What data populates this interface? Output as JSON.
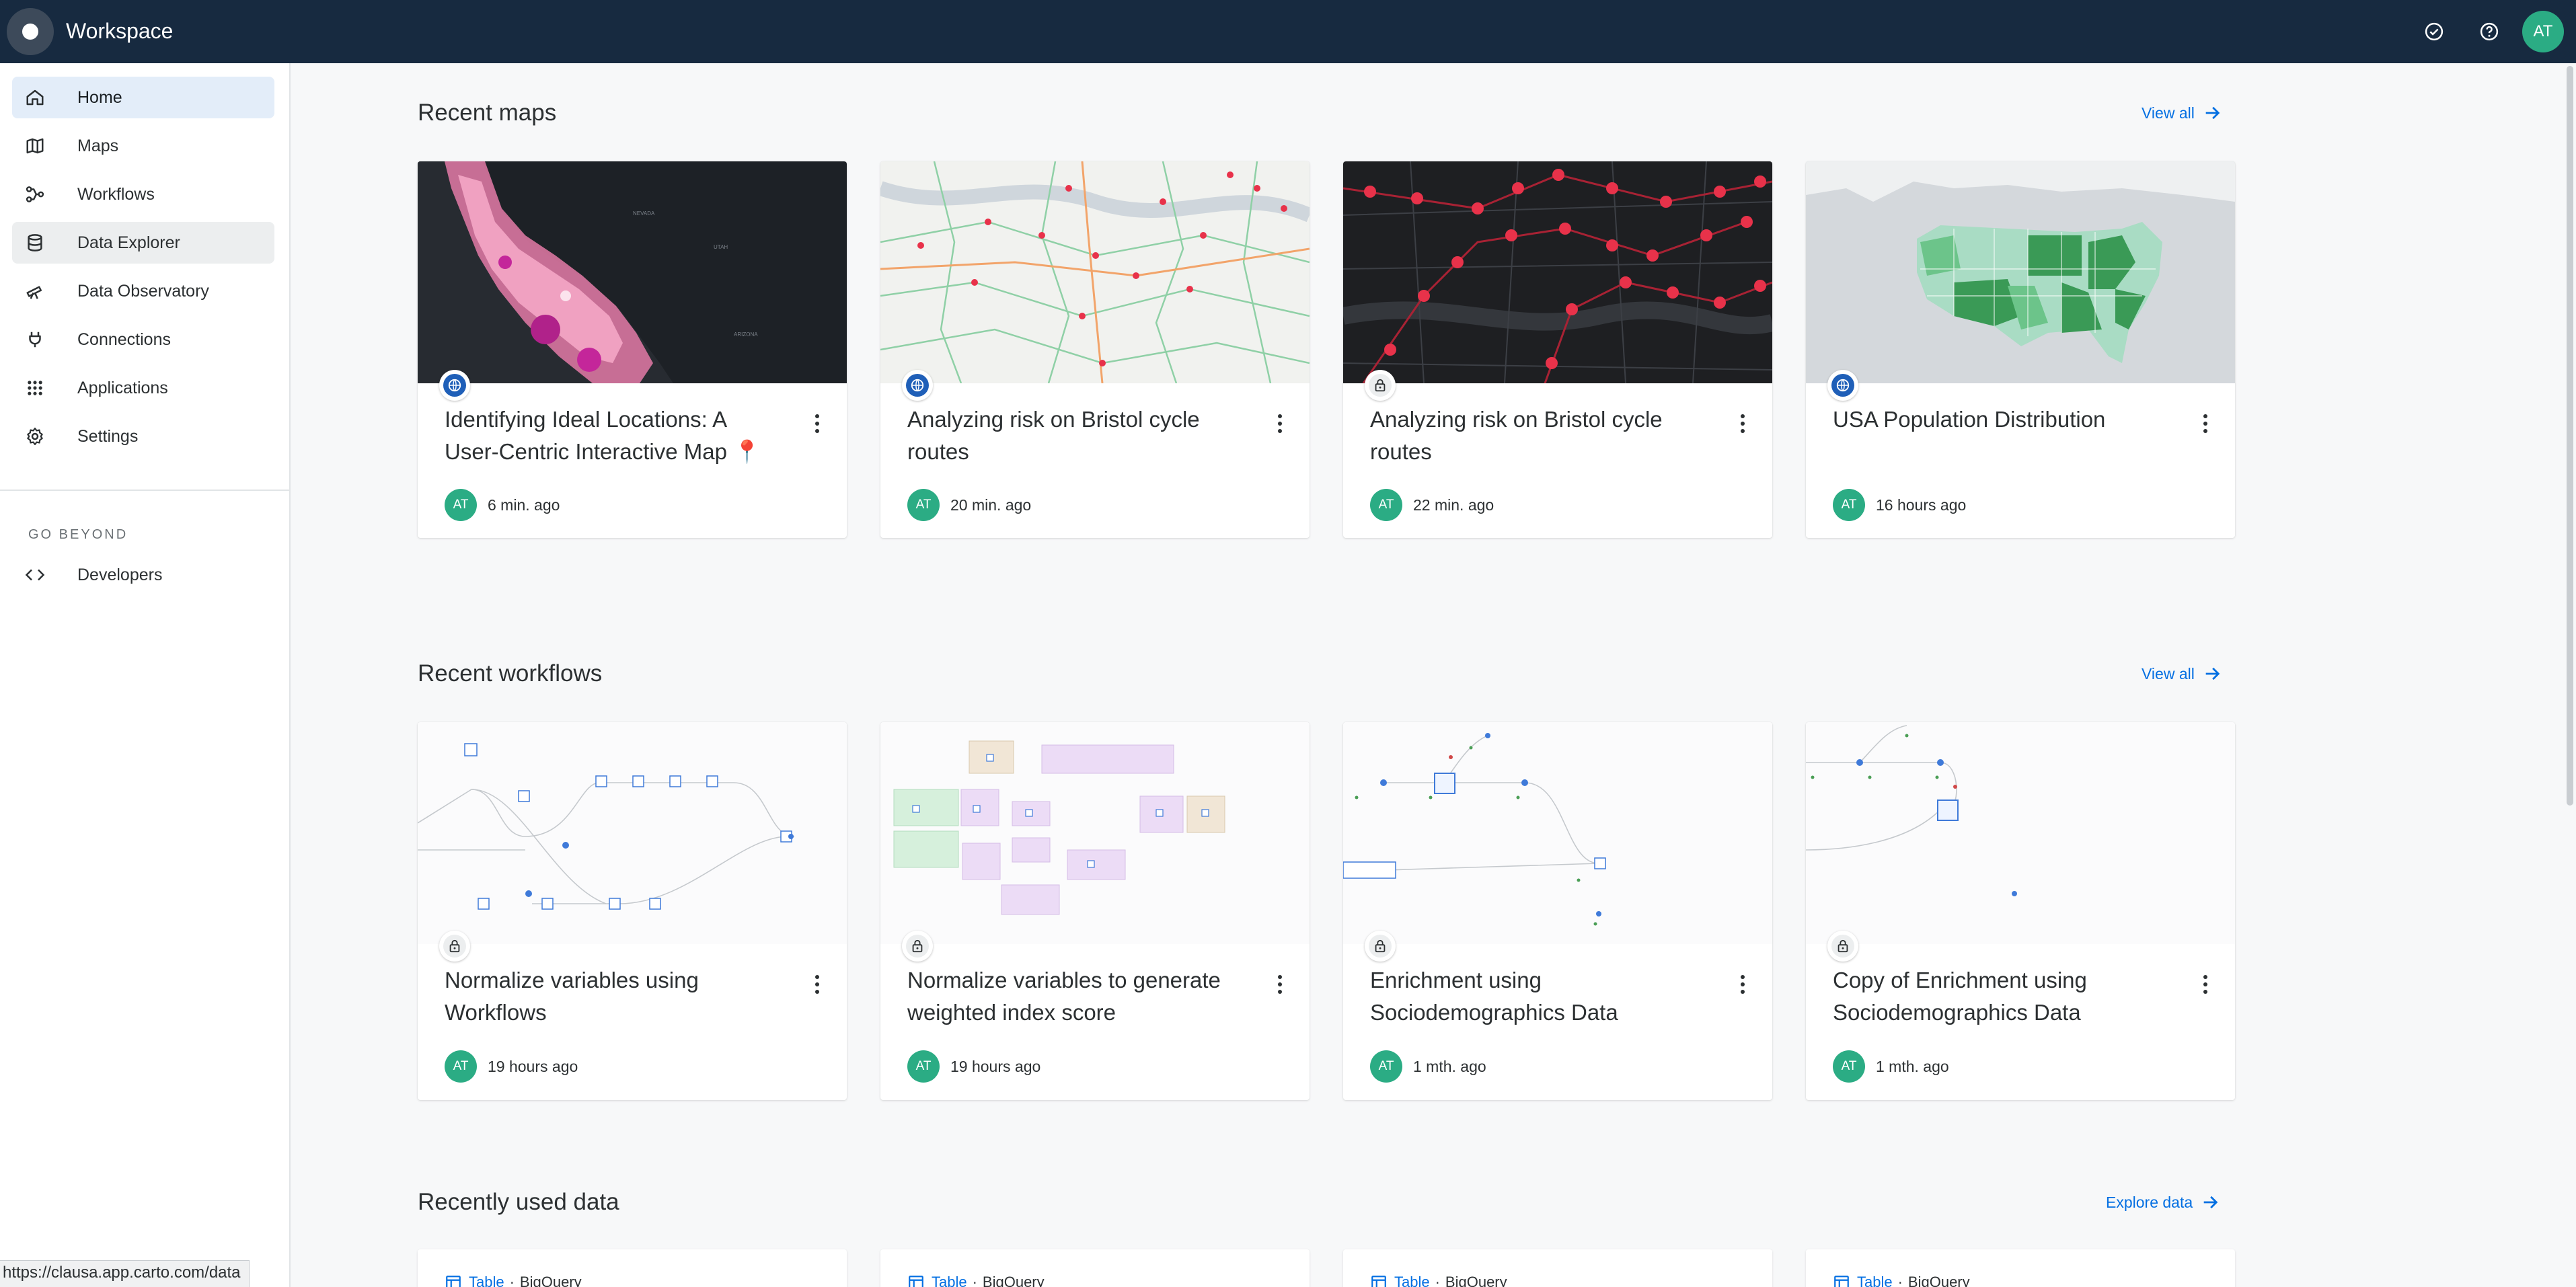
{
  "app": {
    "title": "Workspace",
    "avatar_initials": "AT"
  },
  "sidebar": {
    "items": [
      {
        "label": "Home",
        "icon": "home-icon",
        "state": "active"
      },
      {
        "label": "Maps",
        "icon": "map-icon",
        "state": ""
      },
      {
        "label": "Workflows",
        "icon": "workflow-icon",
        "state": ""
      },
      {
        "label": "Data Explorer",
        "icon": "database-icon",
        "state": "hover"
      },
      {
        "label": "Data Observatory",
        "icon": "telescope-icon",
        "state": ""
      },
      {
        "label": "Connections",
        "icon": "plug-icon",
        "state": ""
      },
      {
        "label": "Applications",
        "icon": "apps-grid-icon",
        "state": ""
      },
      {
        "label": "Settings",
        "icon": "gear-icon",
        "state": ""
      }
    ],
    "section_label": "GO BEYOND",
    "developers_label": "Developers"
  },
  "recent_maps": {
    "title": "Recent maps",
    "view_all": "View all",
    "cards": [
      {
        "title": "Identifying Ideal Locations: A User-Centric Interactive Map 📍",
        "time": "6 min. ago",
        "avatar": "AT",
        "visibility": "public"
      },
      {
        "title": "Analyzing risk on Bristol cycle routes",
        "time": "20 min. ago",
        "avatar": "AT",
        "visibility": "public"
      },
      {
        "title": "Analyzing risk on Bristol cycle routes",
        "time": "22 min. ago",
        "avatar": "AT",
        "visibility": "private"
      },
      {
        "title": "USA Population Distribution",
        "time": "16 hours ago",
        "avatar": "AT",
        "visibility": "public"
      }
    ]
  },
  "recent_workflows": {
    "title": "Recent workflows",
    "view_all": "View all",
    "cards": [
      {
        "title": "Normalize variables using Workflows",
        "time": "19 hours ago",
        "avatar": "AT",
        "visibility": "private"
      },
      {
        "title": "Normalize variables to generate weighted index score",
        "time": "19 hours ago",
        "avatar": "AT",
        "visibility": "private"
      },
      {
        "title": "Enrichment using Sociodemographics Data",
        "time": "1 mth. ago",
        "avatar": "AT",
        "visibility": "private"
      },
      {
        "title": "Copy of Enrichment using Sociodemographics Data",
        "time": "1 mth. ago",
        "avatar": "AT",
        "visibility": "private"
      }
    ]
  },
  "recent_data": {
    "title": "Recently used data",
    "explore": "Explore data",
    "cards": [
      {
        "type": "Table",
        "source": "BigQuery"
      },
      {
        "type": "Table",
        "source": "BigQuery"
      },
      {
        "type": "Table",
        "source": "BigQuery"
      },
      {
        "type": "Table",
        "source": "BigQuery"
      }
    ]
  },
  "status_url": "https://clausa.app.carto.com/data",
  "colors": {
    "topbar": "#172a40",
    "accent": "#036fe2",
    "avatar": "#2bac84",
    "map_red": "#e8324a",
    "map_green": "#2e8b4a"
  }
}
